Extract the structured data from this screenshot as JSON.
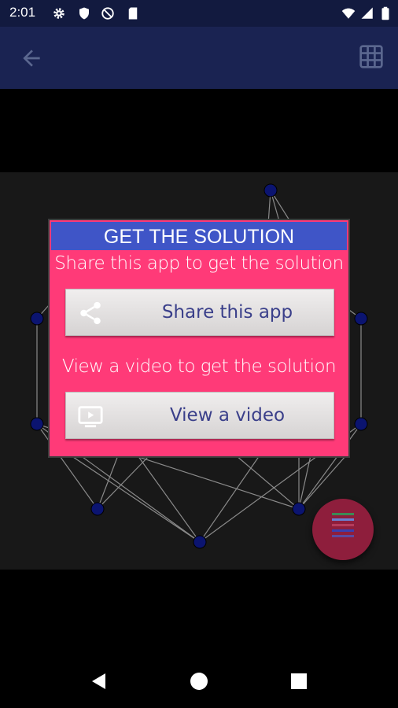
{
  "status_bar": {
    "time": "2:01",
    "icons": [
      "gear-icon",
      "shield-icon",
      "do-not-disturb-icon",
      "sd-card-icon",
      "wifi-icon",
      "signal-icon",
      "battery-icon"
    ]
  },
  "app_bar": {
    "back_icon": "arrow-left-icon",
    "grid_icon": "grid-icon"
  },
  "dialog": {
    "title": "GET THE SOLUTION",
    "share_message": "Share this app to get the solution",
    "share_button_label": "Share this app",
    "share_icon": "share-icon",
    "video_message": "View a video to get the solution",
    "video_button_label": "View a video",
    "video_icon": "video-icon"
  },
  "fab": {
    "icon": "color-bars-icon",
    "bar_colors": [
      "#3c8a55",
      "#6a7fd0",
      "#b53c5c",
      "#3a3fb0",
      "#5a4aa0"
    ]
  },
  "colors": {
    "status_bar": "#121a3f",
    "app_bar": "#1a2352",
    "dialog_bg": "#ff3a78",
    "dialog_title_bg": "#3f55c7",
    "node": "#0b1470",
    "fab": "#8e1e3c"
  },
  "nav_bar": {
    "icons": [
      "back-triangle-icon",
      "home-circle-icon",
      "recents-square-icon"
    ]
  }
}
